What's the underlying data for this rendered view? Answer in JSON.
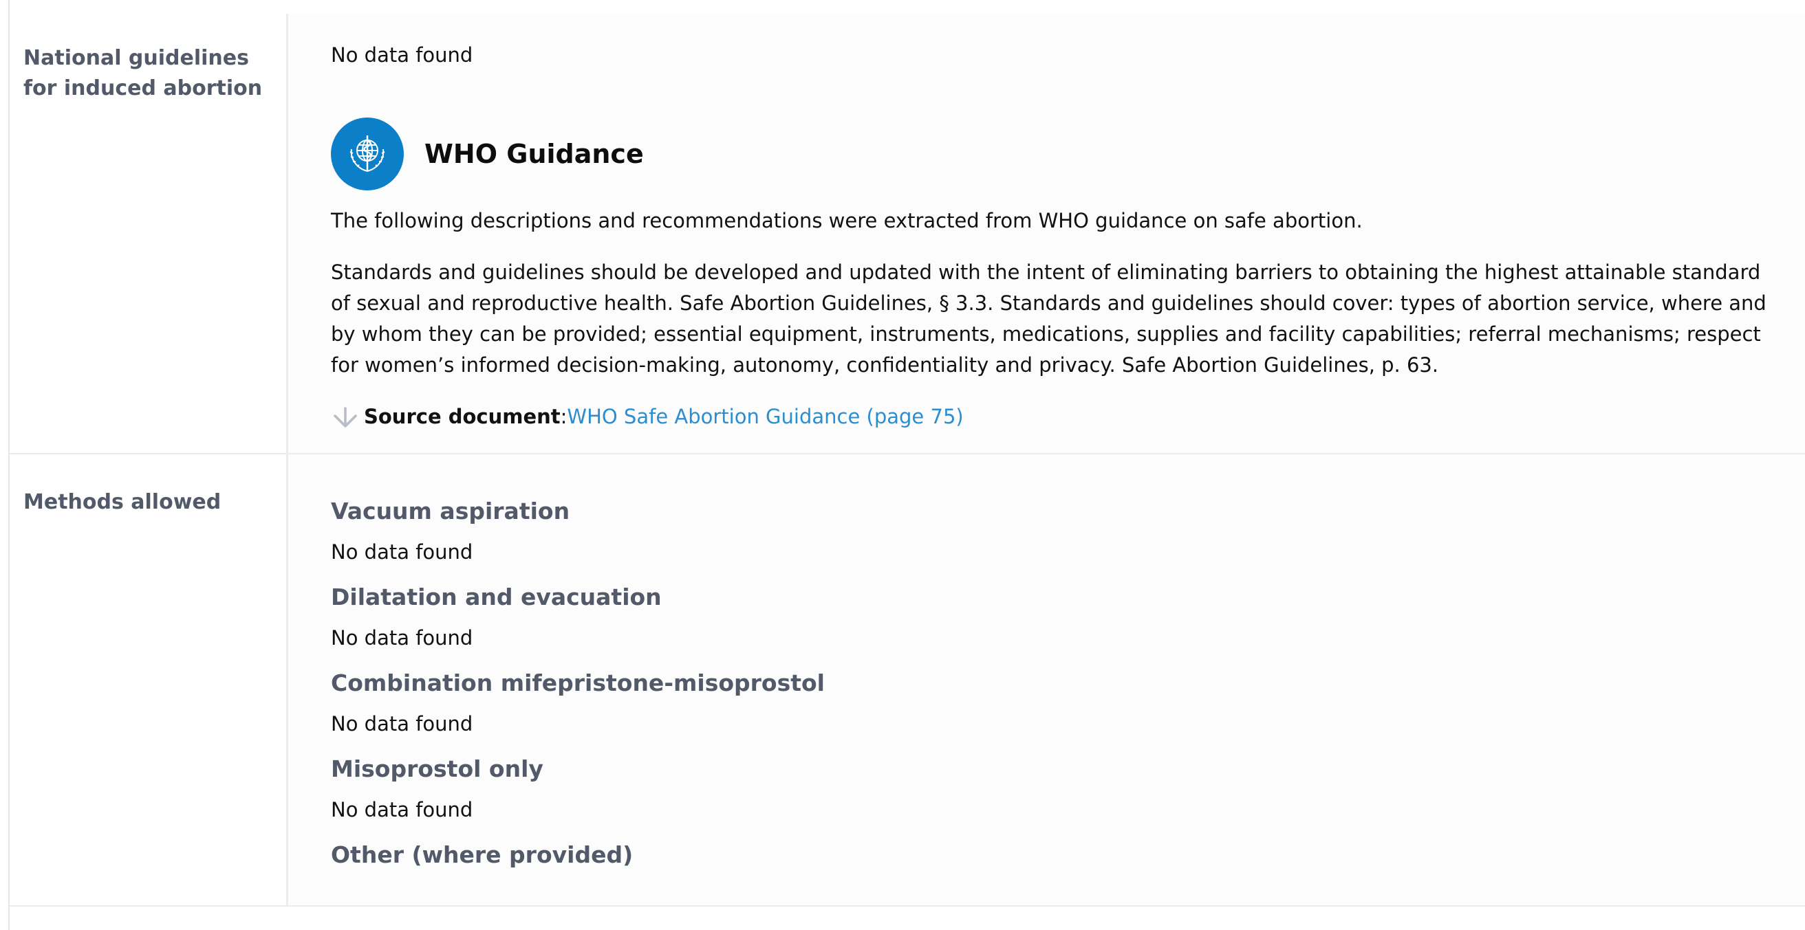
{
  "guidelines": {
    "label": "National guidelines for induced abortion",
    "no_data": "No data found",
    "who": {
      "title": "WHO Guidance",
      "logo_icon": "who-emblem-icon",
      "logo_color": "#0b7fc8",
      "intro": "The following descriptions and recommendations were extracted from WHO guidance on safe abortion.",
      "body": "Standards and guidelines should be developed and updated with the intent of eliminating barriers to obtaining the highest attainable standard of sexual and reproductive health. Safe Abortion Guidelines, § 3.3. Standards and guidelines should cover: types of abortion service, where and by whom they can be provided; essential equipment, instruments, medications, supplies and facility capabilities; referral mechanisms; respect for women’s informed decision-making, autonomy, confidentiality and privacy. Safe Abortion Guidelines, p. 63.",
      "source_label": "Source document",
      "source_sep": ": ",
      "source_link": "WHO Safe Abortion Guidance (page 75)",
      "link_color": "#2b8ed1"
    }
  },
  "methods": {
    "label": "Methods allowed",
    "items": [
      {
        "title": "Vacuum aspiration",
        "value": "No data found"
      },
      {
        "title": "Dilatation and evacuation",
        "value": "No data found"
      },
      {
        "title": "Combination mifepristone-misoprostol",
        "value": "No data found"
      },
      {
        "title": "Misoprostol only",
        "value": "No data found"
      },
      {
        "title": "Other (where provided)",
        "value": ""
      }
    ]
  }
}
